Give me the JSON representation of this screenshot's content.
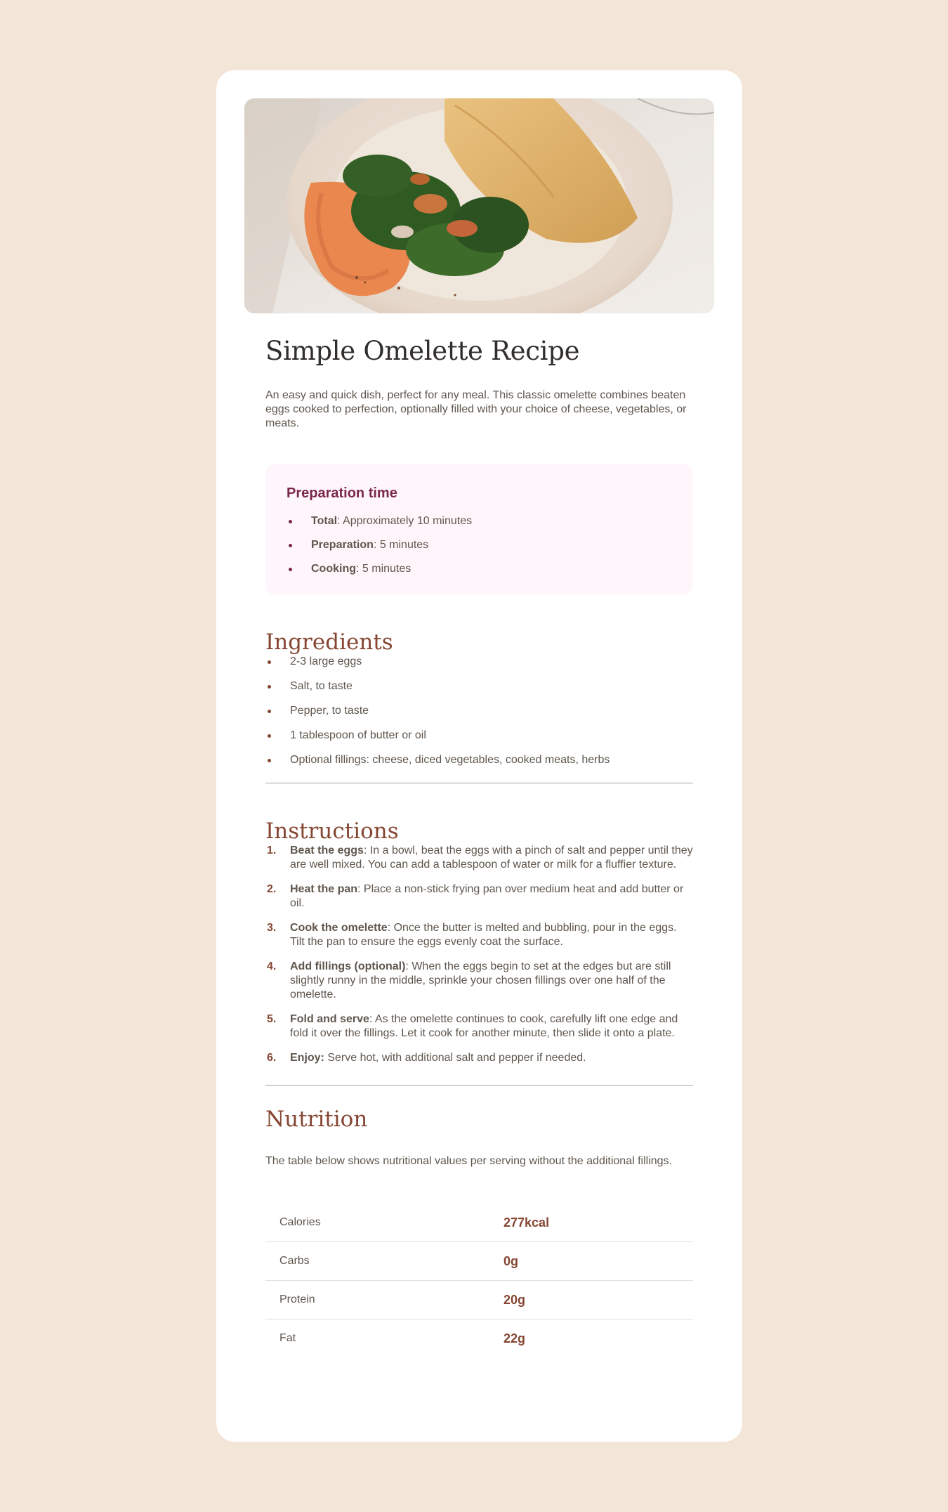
{
  "recipe": {
    "title": "Simple Omelette Recipe",
    "intro": "An easy and quick dish, perfect for any meal. This classic omelette combines beaten eggs cooked to perfection, optionally filled with your choice of cheese, vegetables, or meats.",
    "image_alt": "Omelette served on a plate"
  },
  "preparation": {
    "heading": "Preparation time",
    "items": [
      {
        "label": "Total",
        "value": ": Approximately 10 minutes"
      },
      {
        "label": "Preparation",
        "value": ": 5 minutes"
      },
      {
        "label": "Cooking",
        "value": ": 5 minutes"
      }
    ]
  },
  "ingredients": {
    "heading": "Ingredients",
    "items": [
      "2-3 large eggs",
      "Salt, to taste",
      "Pepper, to taste",
      "1 tablespoon of butter or oil",
      "Optional fillings: cheese, diced vegetables, cooked meats, herbs"
    ]
  },
  "instructions": {
    "heading": "Instructions",
    "steps": [
      {
        "num": "1.",
        "label": "Beat the eggs",
        "text": ": In a bowl, beat the eggs with a pinch of salt and pepper until they are well mixed. You can add a tablespoon of water or milk for a fluffier texture."
      },
      {
        "num": "2.",
        "label": "Heat the pan",
        "text": ": Place a non-stick frying pan over medium heat and add butter or oil."
      },
      {
        "num": "3.",
        "label": "Cook the omelette",
        "text": ": Once the butter is melted and bubbling, pour in the eggs. Tilt the pan to ensure the eggs evenly coat the surface."
      },
      {
        "num": "4.",
        "label": "Add fillings (optional)",
        "text": ": When the eggs begin to set at the edges but are still slightly runny in the middle, sprinkle your chosen fillings over one half of the omelette."
      },
      {
        "num": "5.",
        "label": "Fold and serve",
        "text": ": As the omelette continues to cook, carefully lift one edge and fold it over the fillings. Let it cook for another minute, then slide it onto a plate."
      },
      {
        "num": "6.",
        "label": "Enjoy:",
        "text": " Serve hot, with additional salt and pepper if needed."
      }
    ]
  },
  "nutrition": {
    "heading": "Nutrition",
    "description": "The table below shows nutritional values per serving without the additional fillings.",
    "rows": [
      {
        "name": "Calories",
        "value": "277kcal"
      },
      {
        "name": "Carbs",
        "value": "0g"
      },
      {
        "name": "Protein",
        "value": "20g"
      },
      {
        "name": "Fat",
        "value": "22g"
      }
    ]
  },
  "colors": {
    "page_bg": "#f3e5d8",
    "card_bg": "#ffffff",
    "accent_brown": "#854632",
    "accent_plum": "#7a284e",
    "prep_bg": "#fff6fb",
    "text": "#5f564d",
    "title": "#312e2c"
  }
}
